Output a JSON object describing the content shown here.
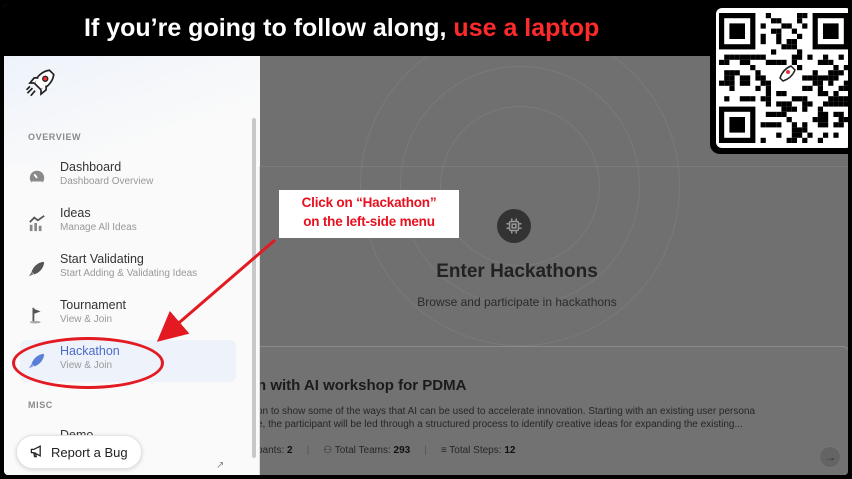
{
  "banner": {
    "text_before": "If you’re going to follow along, ",
    "text_highlight": "use a laptop"
  },
  "sidebar": {
    "section_overview": "OVERVIEW",
    "section_misc": "MISC",
    "items": [
      {
        "title": "Dashboard",
        "subtitle": "Dashboard Overview",
        "icon": "gauge-icon"
      },
      {
        "title": "Ideas",
        "subtitle": "Manage All Ideas",
        "icon": "chart-trend-icon"
      },
      {
        "title": "Start Validating",
        "subtitle": "Start Adding & Validating Ideas",
        "icon": "rocket-icon"
      },
      {
        "title": "Tournament",
        "subtitle": "View & Join",
        "icon": "flag-icon"
      },
      {
        "title": "Hackathon",
        "subtitle": "View & Join",
        "icon": "rocket-icon"
      },
      {
        "title": "Demo",
        "subtitle": "",
        "icon": "demo-icon"
      }
    ],
    "report_bug": "Report a Bug"
  },
  "main": {
    "hero_title": "Enter Hackathons",
    "hero_subtitle": "Browse and participate in hackathons",
    "card": {
      "title": "n with AI workshop for PDMA",
      "description_line1": "on to show some of the ways that AI can be used to accelerate innovation. Starting with an existing user persona",
      "description_line2": "e, the participant will be led through a structured process to identify creative ideas for expanding the existing...",
      "participants_label": "pants:",
      "participants_value": "2",
      "teams_label": "Total Teams:",
      "teams_value": "293",
      "steps_label": "Total Steps:",
      "steps_value": "12"
    }
  },
  "annotation": {
    "line1": "Click on “Hackathon”",
    "line2": "on the left-side menu"
  },
  "colors": {
    "annotation_red": "#e31a22",
    "banner_highlight": "#ff2a2a",
    "active_nav": "#4a6bc9"
  }
}
